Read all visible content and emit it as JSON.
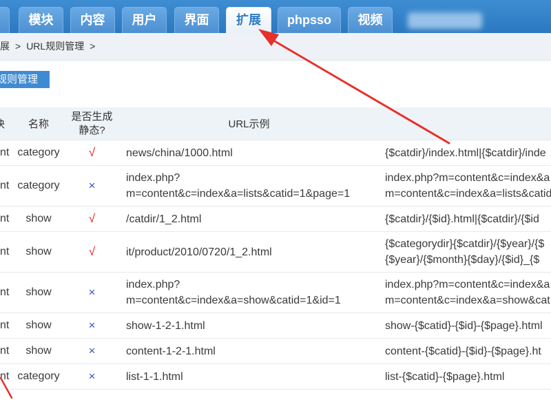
{
  "nav": {
    "tabs": [
      {
        "label": "模块"
      },
      {
        "label": "内容"
      },
      {
        "label": "用户"
      },
      {
        "label": "界面"
      },
      {
        "label": "扩展",
        "active": true
      },
      {
        "label": "phpsso"
      },
      {
        "label": "视频"
      }
    ]
  },
  "breadcrumb": {
    "items": [
      "展",
      ">",
      "URL规则管理",
      ">"
    ]
  },
  "subnav": {
    "current_label": "规则管理"
  },
  "table": {
    "headers": {
      "module": "块",
      "name": "名称",
      "ishtml": [
        "是否生成",
        "静态?"
      ],
      "url_example": "URL示例"
    },
    "rows": [
      {
        "module": "nt",
        "name": "category",
        "ishtml": "√",
        "url_example": [
          "news/china/1000.html"
        ],
        "url_rule": [
          "{$catdir}/index.html|{$catdir}/inde"
        ]
      },
      {
        "module": "nt",
        "name": "category",
        "ishtml": "×",
        "url_example": [
          "index.php?",
          "m=content&c=index&a=lists&catid=1&page=1"
        ],
        "url_rule": [
          "index.php?m=content&c=index&a",
          "m=content&c=index&a=lists&catid"
        ]
      },
      {
        "module": "nt",
        "name": "show",
        "ishtml": "√",
        "url_example": [
          "/catdir/1_2.html"
        ],
        "url_rule": [
          "{$catdir}/{$id}.html|{$catdir}/{$id"
        ]
      },
      {
        "module": "nt",
        "name": "show",
        "ishtml": "√",
        "url_example": [
          "it/product/2010/0720/1_2.html"
        ],
        "url_rule": [
          "{$categorydir}{$catdir}/{$year}/{$",
          "{$year}/{$month}{$day}/{$id}_{$"
        ]
      },
      {
        "module": "nt",
        "name": "show",
        "ishtml": "×",
        "url_example": [
          "index.php?",
          "m=content&c=index&a=show&catid=1&id=1"
        ],
        "url_rule": [
          "index.php?m=content&c=index&a",
          "m=content&c=index&a=show&cat"
        ]
      },
      {
        "module": "nt",
        "name": "show",
        "ishtml": "×",
        "url_example": [
          "show-1-2-1.html"
        ],
        "url_rule": [
          "show-{$catid}-{$id}-{$page}.html"
        ]
      },
      {
        "module": "nt",
        "name": "show",
        "ishtml": "×",
        "url_example": [
          "content-1-2-1.html"
        ],
        "url_rule": [
          "content-{$catid}-{$id}-{$page}.ht"
        ]
      },
      {
        "module": "nt",
        "name": "category",
        "ishtml": "×",
        "url_example": [
          "list-1-1.html"
        ],
        "url_rule": [
          "list-{$catid}-{$page}.html"
        ]
      }
    ]
  },
  "colors": {
    "nav_bar": "#3584ca",
    "tab": "#5b9edb",
    "active_tab_text": "#2e7bc4",
    "subnav_active": "#3f8bd2",
    "header_row": "#eef3f7",
    "static_yes": "#e31b1b",
    "static_no": "#3352cf",
    "annotation_arrow": "#e8302a"
  }
}
